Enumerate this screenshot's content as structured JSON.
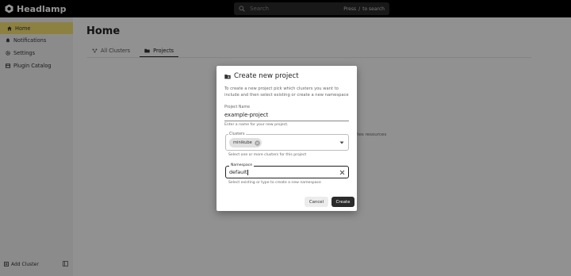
{
  "app": {
    "name": "Headlamp"
  },
  "search": {
    "placeholder": "Search",
    "hint_prefix": "Press",
    "hint_key": "/",
    "hint_suffix": "to search"
  },
  "sidebar": {
    "items": [
      {
        "label": "Home",
        "icon": "home-icon",
        "active": true
      },
      {
        "label": "Notifications",
        "icon": "bell-icon"
      },
      {
        "label": "Settings",
        "icon": "gear-icon"
      },
      {
        "label": "Plugin Catalog",
        "icon": "catalog-icon"
      }
    ],
    "add_cluster": "Add Cluster"
  },
  "main": {
    "title": "Home",
    "tabs": [
      {
        "label": "All Clusters",
        "icon": "clusters-icon"
      },
      {
        "label": "Projects",
        "icon": "folder-icon",
        "active": true
      }
    ],
    "background_text": "ates resources"
  },
  "dialog": {
    "title": "Create new project",
    "description": "To create a new project pick which clusters you want to include and then select existing or create a new namespace",
    "project_name": {
      "label": "Project Name",
      "value": "example-project",
      "helper": "Enter a name for your new project."
    },
    "clusters": {
      "label": "Clusters",
      "selected": [
        "minikube"
      ],
      "helper": "Select one or more clusters for this project"
    },
    "namespace": {
      "label": "Namespace",
      "value": "default",
      "helper": "Select existing or type to create a new namespace"
    },
    "cancel_label": "Cancel",
    "create_label": "Create"
  },
  "colors": {
    "accent": "#f2df6f",
    "topbar": "#000000",
    "primary_button": "#2b2b2b"
  }
}
